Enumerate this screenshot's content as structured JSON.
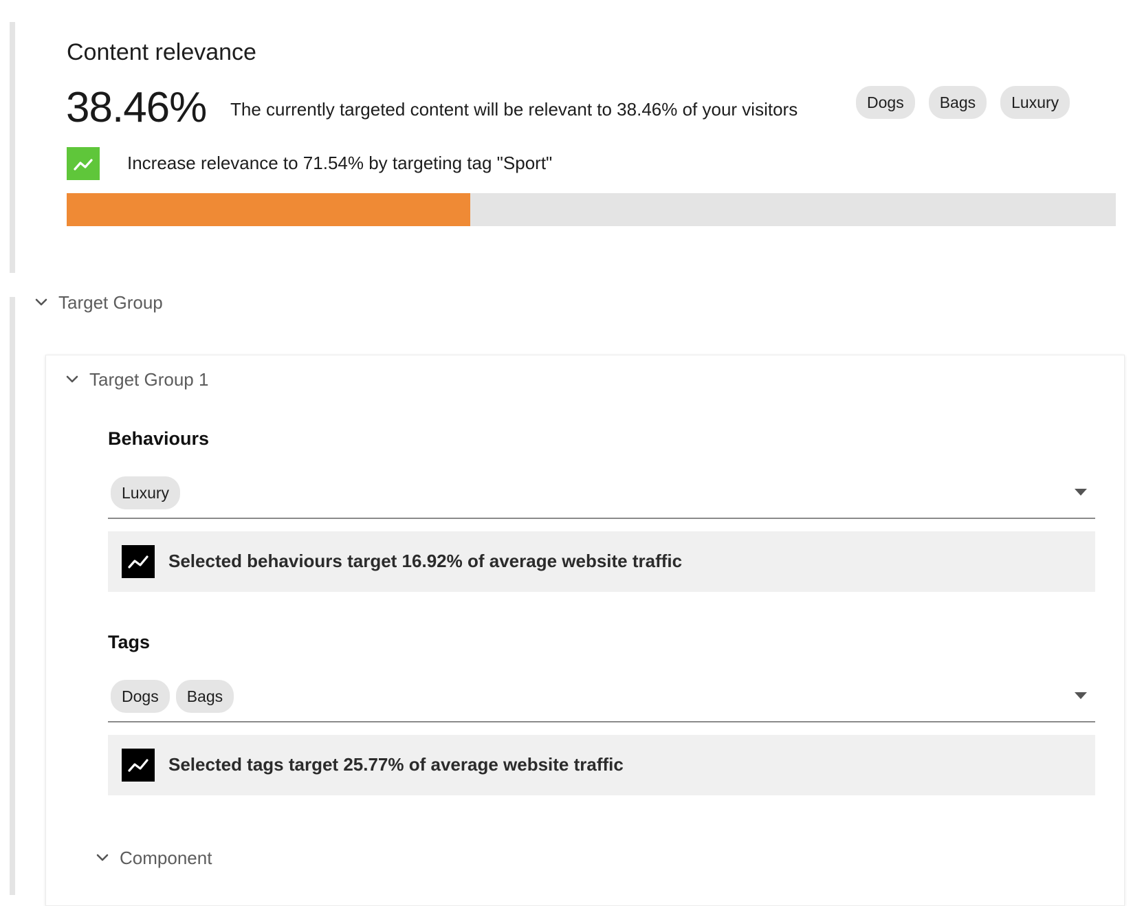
{
  "relevance": {
    "title": "Content relevance",
    "percent_text": "38.46%",
    "percent_value": 38.46,
    "description": "The currently targeted content will be relevant to 38.46% of your visitors",
    "tags": [
      "Dogs",
      "Bags",
      "Luxury"
    ],
    "increase_text": "Increase relevance to 71.54% by targeting tag \"Sport\"",
    "increase_icon": "trending-up-icon",
    "colors": {
      "progress_fill": "#ef8a35",
      "progress_track": "#e4e4e4",
      "increase_icon_bg": "#5fc63a"
    }
  },
  "target_group": {
    "section_label": "Target Group",
    "group_label": "Target Group 1",
    "behaviours": {
      "heading": "Behaviours",
      "selected": [
        "Luxury"
      ],
      "info": "Selected behaviours target 16.92% of average website traffic"
    },
    "tags": {
      "heading": "Tags",
      "selected": [
        "Dogs",
        "Bags"
      ],
      "info": "Selected tags target 25.77% of average website traffic"
    },
    "component_label": "Component"
  }
}
